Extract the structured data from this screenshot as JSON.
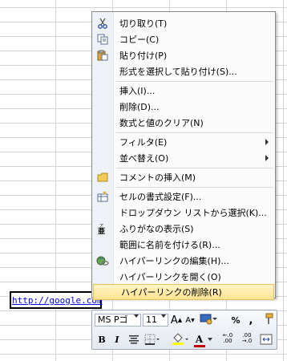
{
  "cell": {
    "value": "http://google.com"
  },
  "menu": {
    "items": [
      {
        "label": "切り取り(T)",
        "icon": "scissors-icon"
      },
      {
        "label": "コピー(C)",
        "icon": "copy-icon"
      },
      {
        "label": "貼り付け(P)",
        "icon": "paste-icon"
      },
      {
        "label": "形式を選択して貼り付け(S)..."
      },
      {
        "label": "挿入(I)..."
      },
      {
        "label": "削除(D)..."
      },
      {
        "label": "数式と値のクリア(N)"
      },
      {
        "label": "フィルタ(E)",
        "submenu": true
      },
      {
        "label": "並べ替え(O)",
        "submenu": true
      },
      {
        "label": "コメントの挿入(M)",
        "icon": "comment-icon"
      },
      {
        "label": "セルの書式設定(F)...",
        "icon": "format-cells-icon"
      },
      {
        "label": "ドロップダウン リストから選択(K)..."
      },
      {
        "label": "ふりがなの表示(S)",
        "icon": "furigana-icon"
      },
      {
        "label": "範囲に名前を付ける(R)..."
      },
      {
        "label": "ハイパーリンクの編集(H)...",
        "icon": "hyperlink-icon"
      },
      {
        "label": "ハイパーリンクを開く(O)"
      },
      {
        "label": "ハイパーリンクの削除(R)",
        "highlighted": true
      }
    ]
  },
  "toolbar": {
    "font_name": "MS Pゴ",
    "font_size": "11",
    "grow_font": "A",
    "shrink_font": "A",
    "percent": "%",
    "comma": ",",
    "bold": "B",
    "italic": "I",
    "font_color": "A",
    "inc_decimal": ".0\n.00",
    "dec_decimal": ".00\n.0",
    "accent": "#c00000",
    "fill_color": "#ffff00"
  }
}
